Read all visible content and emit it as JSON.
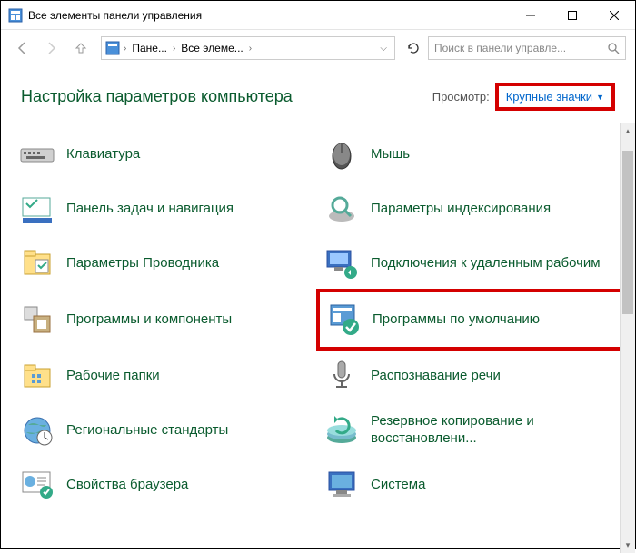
{
  "window": {
    "title": "Все элементы панели управления"
  },
  "breadcrumb": {
    "item1": "Пане...",
    "item2": "Все элеме..."
  },
  "search": {
    "placeholder": "Поиск в панели управле..."
  },
  "header": {
    "heading": "Настройка параметров компьютера",
    "view_label": "Просмотр:",
    "view_value": "Крупные значки"
  },
  "items": {
    "left": [
      {
        "label": "Клавиатура"
      },
      {
        "label": "Панель задач и навигация"
      },
      {
        "label": "Параметры Проводника"
      },
      {
        "label": "Программы и компоненты"
      },
      {
        "label": "Рабочие папки"
      },
      {
        "label": "Региональные стандарты"
      },
      {
        "label": "Свойства браузера"
      }
    ],
    "right": [
      {
        "label": "Мышь"
      },
      {
        "label": "Параметры индексирования"
      },
      {
        "label": "Подключения к удаленным рабочим"
      },
      {
        "label": "Программы по умолчанию"
      },
      {
        "label": "Распознавание речи"
      },
      {
        "label": "Резервное копирование и восстановлени..."
      },
      {
        "label": "Система"
      }
    ]
  }
}
